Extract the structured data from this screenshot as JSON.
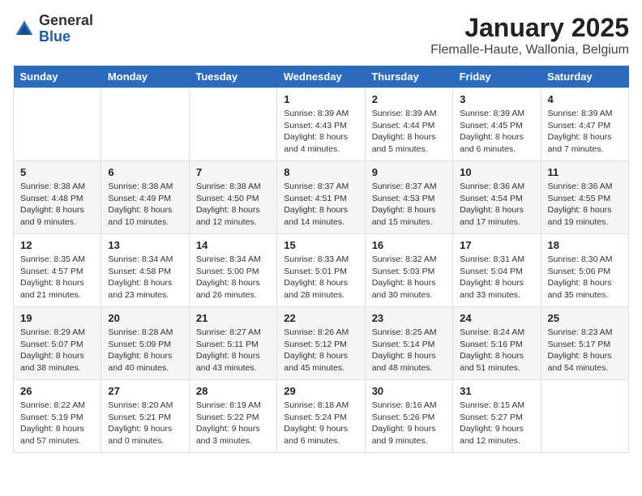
{
  "logo": {
    "general": "General",
    "blue": "Blue"
  },
  "title": "January 2025",
  "subtitle": "Flemalle-Haute, Wallonia, Belgium",
  "days_of_week": [
    "Sunday",
    "Monday",
    "Tuesday",
    "Wednesday",
    "Thursday",
    "Friday",
    "Saturday"
  ],
  "weeks": [
    [
      {
        "day": "",
        "info": ""
      },
      {
        "day": "",
        "info": ""
      },
      {
        "day": "",
        "info": ""
      },
      {
        "day": "1",
        "info": "Sunrise: 8:39 AM\nSunset: 4:43 PM\nDaylight: 8 hours and 4 minutes."
      },
      {
        "day": "2",
        "info": "Sunrise: 8:39 AM\nSunset: 4:44 PM\nDaylight: 8 hours and 5 minutes."
      },
      {
        "day": "3",
        "info": "Sunrise: 8:39 AM\nSunset: 4:45 PM\nDaylight: 8 hours and 6 minutes."
      },
      {
        "day": "4",
        "info": "Sunrise: 8:39 AM\nSunset: 4:47 PM\nDaylight: 8 hours and 7 minutes."
      }
    ],
    [
      {
        "day": "5",
        "info": "Sunrise: 8:38 AM\nSunset: 4:48 PM\nDaylight: 8 hours and 9 minutes."
      },
      {
        "day": "6",
        "info": "Sunrise: 8:38 AM\nSunset: 4:49 PM\nDaylight: 8 hours and 10 minutes."
      },
      {
        "day": "7",
        "info": "Sunrise: 8:38 AM\nSunset: 4:50 PM\nDaylight: 8 hours and 12 minutes."
      },
      {
        "day": "8",
        "info": "Sunrise: 8:37 AM\nSunset: 4:51 PM\nDaylight: 8 hours and 14 minutes."
      },
      {
        "day": "9",
        "info": "Sunrise: 8:37 AM\nSunset: 4:53 PM\nDaylight: 8 hours and 15 minutes."
      },
      {
        "day": "10",
        "info": "Sunrise: 8:36 AM\nSunset: 4:54 PM\nDaylight: 8 hours and 17 minutes."
      },
      {
        "day": "11",
        "info": "Sunrise: 8:36 AM\nSunset: 4:55 PM\nDaylight: 8 hours and 19 minutes."
      }
    ],
    [
      {
        "day": "12",
        "info": "Sunrise: 8:35 AM\nSunset: 4:57 PM\nDaylight: 8 hours and 21 minutes."
      },
      {
        "day": "13",
        "info": "Sunrise: 8:34 AM\nSunset: 4:58 PM\nDaylight: 8 hours and 23 minutes."
      },
      {
        "day": "14",
        "info": "Sunrise: 8:34 AM\nSunset: 5:00 PM\nDaylight: 8 hours and 26 minutes."
      },
      {
        "day": "15",
        "info": "Sunrise: 8:33 AM\nSunset: 5:01 PM\nDaylight: 8 hours and 28 minutes."
      },
      {
        "day": "16",
        "info": "Sunrise: 8:32 AM\nSunset: 5:03 PM\nDaylight: 8 hours and 30 minutes."
      },
      {
        "day": "17",
        "info": "Sunrise: 8:31 AM\nSunset: 5:04 PM\nDaylight: 8 hours and 33 minutes."
      },
      {
        "day": "18",
        "info": "Sunrise: 8:30 AM\nSunset: 5:06 PM\nDaylight: 8 hours and 35 minutes."
      }
    ],
    [
      {
        "day": "19",
        "info": "Sunrise: 8:29 AM\nSunset: 5:07 PM\nDaylight: 8 hours and 38 minutes."
      },
      {
        "day": "20",
        "info": "Sunrise: 8:28 AM\nSunset: 5:09 PM\nDaylight: 8 hours and 40 minutes."
      },
      {
        "day": "21",
        "info": "Sunrise: 8:27 AM\nSunset: 5:11 PM\nDaylight: 8 hours and 43 minutes."
      },
      {
        "day": "22",
        "info": "Sunrise: 8:26 AM\nSunset: 5:12 PM\nDaylight: 8 hours and 45 minutes."
      },
      {
        "day": "23",
        "info": "Sunrise: 8:25 AM\nSunset: 5:14 PM\nDaylight: 8 hours and 48 minutes."
      },
      {
        "day": "24",
        "info": "Sunrise: 8:24 AM\nSunset: 5:16 PM\nDaylight: 8 hours and 51 minutes."
      },
      {
        "day": "25",
        "info": "Sunrise: 8:23 AM\nSunset: 5:17 PM\nDaylight: 8 hours and 54 minutes."
      }
    ],
    [
      {
        "day": "26",
        "info": "Sunrise: 8:22 AM\nSunset: 5:19 PM\nDaylight: 8 hours and 57 minutes."
      },
      {
        "day": "27",
        "info": "Sunrise: 8:20 AM\nSunset: 5:21 PM\nDaylight: 9 hours and 0 minutes."
      },
      {
        "day": "28",
        "info": "Sunrise: 8:19 AM\nSunset: 5:22 PM\nDaylight: 9 hours and 3 minutes."
      },
      {
        "day": "29",
        "info": "Sunrise: 8:18 AM\nSunset: 5:24 PM\nDaylight: 9 hours and 6 minutes."
      },
      {
        "day": "30",
        "info": "Sunrise: 8:16 AM\nSunset: 5:26 PM\nDaylight: 9 hours and 9 minutes."
      },
      {
        "day": "31",
        "info": "Sunrise: 8:15 AM\nSunset: 5:27 PM\nDaylight: 9 hours and 12 minutes."
      },
      {
        "day": "",
        "info": ""
      }
    ]
  ]
}
